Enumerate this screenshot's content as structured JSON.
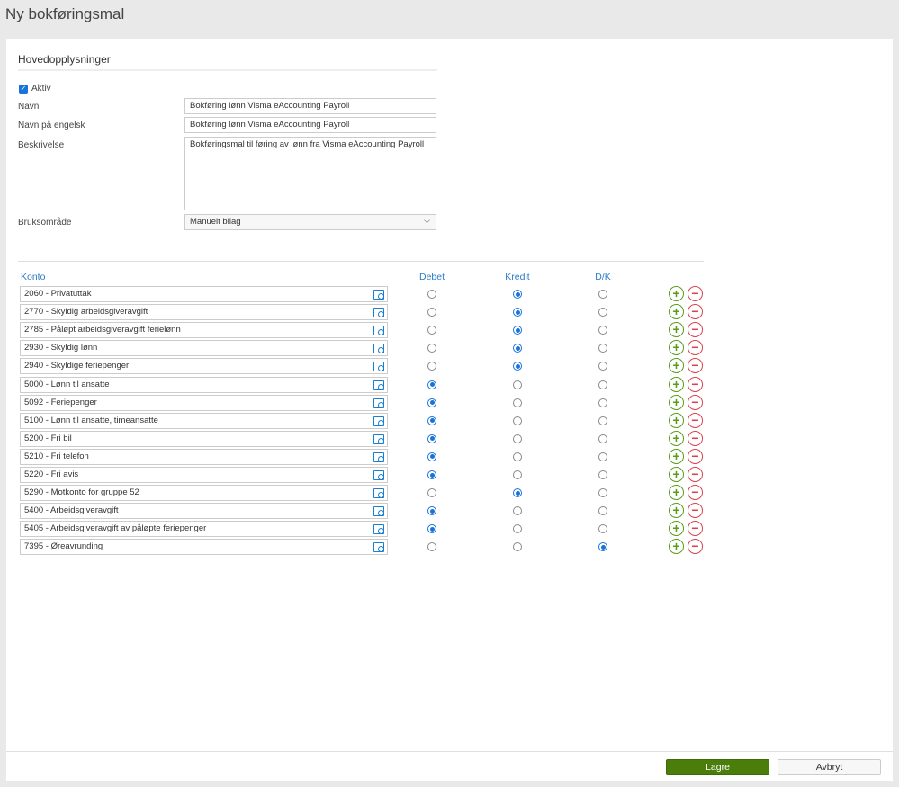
{
  "page_title": "Ny bokføringsmal",
  "section_title": "Hovedopplysninger",
  "aktiv": {
    "label": "Aktiv",
    "checked": true
  },
  "navn": {
    "label": "Navn",
    "value": "Bokføring lønn Visma eAccounting Payroll"
  },
  "navn_engelsk": {
    "label": "Navn på engelsk",
    "value": "Bokføring lønn Visma eAccounting Payroll"
  },
  "beskrivelse": {
    "label": "Beskrivelse",
    "value": "Bokføringsmal til føring av lønn fra Visma eAccounting Payroll"
  },
  "bruksomrade": {
    "label": "Bruksområde",
    "value": "Manuelt bilag"
  },
  "columns": {
    "konto": "Konto",
    "debet": "Debet",
    "kredit": "Kredit",
    "dk": "D/K"
  },
  "rows": [
    {
      "konto": "2060 - Privatuttak",
      "sel": "kredit"
    },
    {
      "konto": "2770 - Skyldig arbeidsgiveravgift",
      "sel": "kredit"
    },
    {
      "konto": "2785 - Påløpt arbeidsgiveravgift feriel ønn",
      "sel": "kredit"
    },
    {
      "konto": "2930 - Skyldig lønn",
      "sel": "kredit"
    },
    {
      "konto": "2940 - Skyldige feriepenger",
      "sel": "kredit"
    },
    {
      "konto": "5000 - Lønn til ansatte",
      "sel": "debet"
    },
    {
      "konto": "5092 - Feriepenger",
      "sel": "debet"
    },
    {
      "konto": "5100 - Lønn til ansatte, timeansatte",
      "sel": "debet"
    },
    {
      "konto": "5200 - Fri bil",
      "sel": "debet"
    },
    {
      "konto": "5210 - Fri telefon",
      "sel": "debet"
    },
    {
      "konto": "5220 - Fri avis",
      "sel": "debet"
    },
    {
      "konto": "5290 - Motkonto for gruppe 52",
      "sel": "kredit"
    },
    {
      "konto": "5400 - Arbeidsgiveravgift",
      "sel": "debet"
    },
    {
      "konto": "5405 - Arbeidsgiveravgift av påløpte feriepenger",
      "sel": "debet"
    },
    {
      "konto": "7395 - Øreavrunding",
      "sel": "dk"
    }
  ],
  "buttons": {
    "save": "Lagre",
    "cancel": "Avbryt"
  }
}
